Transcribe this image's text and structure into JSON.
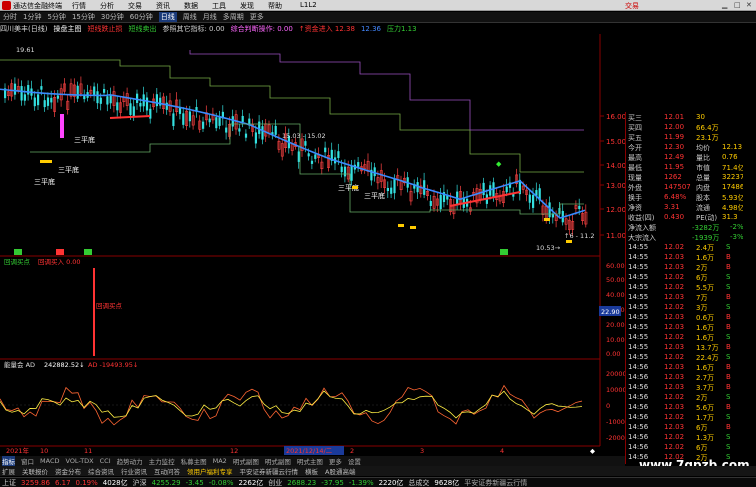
{
  "titlebar": {
    "app_name": "通达信金融终端",
    "menu": [
      "行情",
      "分析",
      "交易",
      "资讯",
      "数据",
      "工具",
      "发现",
      "帮助"
    ],
    "middle_text": "L1L2",
    "trade_label": "交易"
  },
  "periodbar": {
    "items": [
      "分时",
      "1分钟",
      "5分钟",
      "15分钟",
      "30分钟",
      "60分钟",
      "日线",
      "周线",
      "月线",
      "多周期",
      "更多"
    ],
    "active_index": 6
  },
  "infobar": [
    {
      "text": "四川美丰(日线)",
      "color": "#dddddd"
    },
    {
      "text": "操盘主图",
      "color": "#ffffff"
    },
    {
      "text": "短线跌止损",
      "color": "#ff3333"
    },
    {
      "text": "短线卖出",
      "color": "#33cc33"
    },
    {
      "text": "参照其它指标: 0.00",
      "color": "#cccccc"
    },
    {
      "text": "综合判断操作: 0.00",
      "color": "#ff66ff"
    },
    {
      "text": "↑资金进入 12.38",
      "color": "#ff3333"
    },
    {
      "text": "12.36",
      "color": "#4488ff"
    },
    {
      "text": "压力1.13",
      "color": "#33cc33"
    }
  ],
  "chart": {
    "price_axis": [
      "16.00",
      "15.00",
      "14.00",
      "13.00",
      "12.00",
      "11.00"
    ],
    "price_label_high": "19.61",
    "range_label": "15.03 - 15.02",
    "low_marker": "10.53",
    "low_right_label": "↑6 - 11.2",
    "callouts": [
      "三平底",
      "三平底",
      "三平底",
      "三平底"
    ],
    "diamond_label": "◆",
    "pane2_title": "回调买点",
    "pane2_value": "回调买入 0.00",
    "pane2_axis": [
      "60.00",
      "50.00",
      "40.00",
      "30.00",
      "20.00",
      "10.00",
      "0.00"
    ],
    "pane2_current": "22.90",
    "pane2_arrow_label": "回调买点",
    "pane3_title": "能量会 AD",
    "pane3_value": "242882.52↓",
    "pane3_value2": "AD -19493.95↓",
    "pane3_axis": [
      "20000",
      "10000",
      "0",
      "-10000",
      "-20000"
    ],
    "date_axis": [
      "2021年",
      "10",
      "11",
      "12",
      "2021/12/14/二",
      "2",
      "3",
      "4"
    ],
    "bottom_right_marker": "◆"
  },
  "quote": {
    "top_rows": [
      {
        "label": "买三",
        "price": "12.01",
        "vol": "30",
        "extra": ""
      },
      {
        "label": "买四",
        "price": "12.00",
        "vol": "66.4万",
        "extra": ""
      },
      {
        "label": "买五",
        "price": "11.99",
        "vol": "23.1万",
        "extra": ""
      },
      {
        "label": "今开",
        "price": "12.30",
        "vol": "均价",
        "extra": "12.13"
      },
      {
        "label": "最高",
        "price": "12.49",
        "vol": "量比",
        "extra": "0.76"
      },
      {
        "label": "最低",
        "price": "11.95",
        "vol": "市值",
        "extra": "71.4亿"
      },
      {
        "label": "现量",
        "price": "1262",
        "vol": "总量",
        "extra": "322375"
      },
      {
        "label": "外盘",
        "price": "147507",
        "vol": "内盘",
        "extra": "174868"
      },
      {
        "label": "换手",
        "price": "6.48%",
        "vol": "股本",
        "extra": "5.93亿"
      },
      {
        "label": "净资",
        "price": "3.31",
        "vol": "流通",
        "extra": "4.98亿"
      },
      {
        "label": "收益(四)",
        "price": "0.430",
        "vol": "PE(动)",
        "extra": "31.3"
      }
    ],
    "flow_rows": [
      {
        "label": "净流入额",
        "value": "-3282万",
        "pct": "-2%"
      },
      {
        "label": "大宗流入",
        "value": "-1939万",
        "pct": "-3%"
      }
    ],
    "ticks": [
      {
        "time": "14:55",
        "price": "12.02",
        "vol": "2.4万",
        "side": "S"
      },
      {
        "time": "14:55",
        "price": "12.03",
        "vol": "1.6万",
        "side": "B"
      },
      {
        "time": "14:55",
        "price": "12.03",
        "vol": "2万",
        "side": "B"
      },
      {
        "time": "14:55",
        "price": "12.02",
        "vol": "6万",
        "side": "S"
      },
      {
        "time": "14:55",
        "price": "12.02",
        "vol": "5.5万",
        "side": "S"
      },
      {
        "time": "14:55",
        "price": "12.03",
        "vol": "7万",
        "side": "B"
      },
      {
        "time": "14:55",
        "price": "12.02",
        "vol": "3万",
        "side": "S"
      },
      {
        "time": "14:55",
        "price": "12.03",
        "vol": "0.6万",
        "side": "B"
      },
      {
        "time": "14:55",
        "price": "12.03",
        "vol": "1.6万",
        "side": "B"
      },
      {
        "time": "14:55",
        "price": "12.02",
        "vol": "1.6万",
        "side": "S"
      },
      {
        "time": "14:55",
        "price": "12.03",
        "vol": "13.7万",
        "side": "B"
      },
      {
        "time": "14:55",
        "price": "12.02",
        "vol": "22.4万",
        "side": "S"
      },
      {
        "time": "14:56",
        "price": "12.03",
        "vol": "1.6万",
        "side": "B"
      },
      {
        "time": "14:56",
        "price": "12.03",
        "vol": "2.7万",
        "side": "B"
      },
      {
        "time": "14:56",
        "price": "12.03",
        "vol": "3.7万",
        "side": "B"
      },
      {
        "time": "14:56",
        "price": "12.02",
        "vol": "2万",
        "side": "S"
      },
      {
        "time": "14:56",
        "price": "12.03",
        "vol": "5.6万",
        "side": "B"
      },
      {
        "time": "14:56",
        "price": "12.02",
        "vol": "1.7万",
        "side": "S"
      },
      {
        "time": "14:56",
        "price": "12.03",
        "vol": "6万",
        "side": "B"
      },
      {
        "time": "14:56",
        "price": "12.02",
        "vol": "1.3万",
        "side": "S"
      },
      {
        "time": "14:56",
        "price": "12.02",
        "vol": "6万",
        "side": "S"
      },
      {
        "time": "14:56",
        "price": "12.02",
        "vol": "2万",
        "side": "S"
      },
      {
        "time": "14:56",
        "price": "12.03",
        "vol": "1.6万",
        "side": "B"
      },
      {
        "time": "14:56",
        "price": "12.02",
        "vol": "3.6万",
        "side": "S"
      }
    ]
  },
  "watermark": "www.7gpzb.com",
  "bottom_tabs": {
    "items": [
      "指标",
      "窗口",
      "MACD",
      "VOL-TDX",
      "CCI",
      "趋势动力",
      "主力监控",
      "私募主图",
      "MA2",
      "明式副图",
      "明式副图",
      "明式主图",
      "更多",
      "设置"
    ],
    "active_index": 0
  },
  "feature_bar": {
    "items": [
      "扩展",
      "关联报价",
      "资金分布",
      "综合资讯",
      "行业资讯",
      "互动问答",
      "领用户福利专享",
      "平安证券新疆云行情",
      "横板",
      "A股通高端"
    ],
    "hot_indices": [
      6
    ]
  },
  "status": [
    {
      "label": "上证",
      "value": "3259.86",
      "change": "6.17",
      "pct": "0.19%",
      "amount": "4028亿",
      "color": "#ff3333"
    },
    {
      "label": "沪深",
      "value": "4255.29",
      "change": "-3.45",
      "pct": "-0.08%",
      "amount": "2262亿",
      "color": "#33cc33"
    },
    {
      "label": "创业",
      "value": "2688.23",
      "change": "-37.95",
      "pct": "-1.39%",
      "amount": "2220亿",
      "color": "#33cc33"
    },
    {
      "label": "总成交",
      "value": "",
      "change": "",
      "pct": "",
      "amount": "9628亿",
      "color": "#ffffff"
    }
  ],
  "status_trailer": "平安证券新疆云行情"
}
